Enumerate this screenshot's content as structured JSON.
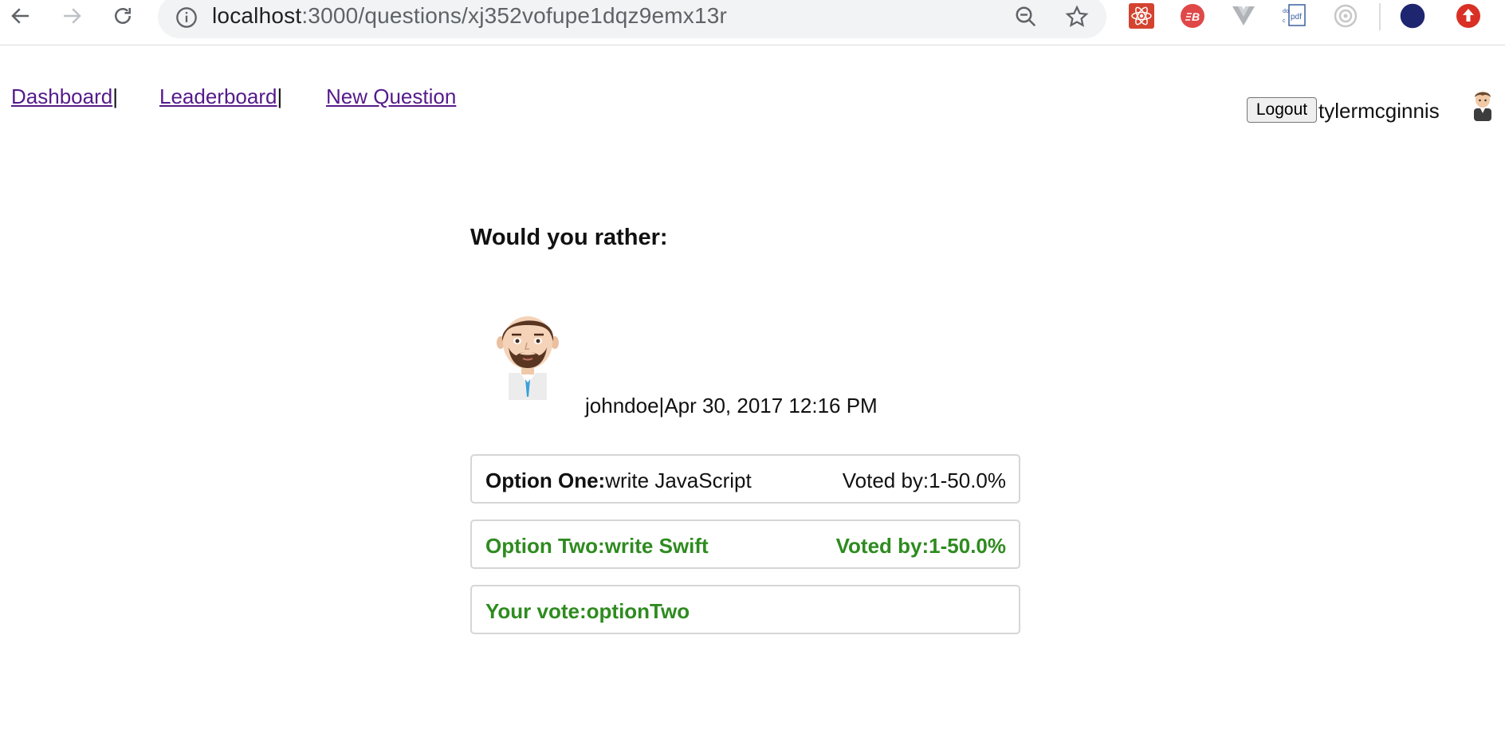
{
  "browser": {
    "url_host": "localhost",
    "url_path": ":3000/questions/xj352vofupe1dqz9emx13r",
    "icons": [
      "back-icon",
      "forward-icon",
      "reload-icon",
      "info-icon",
      "zoom-out-icon",
      "star-icon",
      "react-devtools-icon",
      "bnb-extension-icon",
      "vue-devtools-icon",
      "pdf-extension-icon",
      "redux-devtools-icon",
      "profile-icon",
      "update-icon"
    ]
  },
  "nav": {
    "dashboard": "Dashboard",
    "leaderboard": "Leaderboard",
    "new_question": "New Question",
    "separator": "|",
    "logout": "Logout",
    "username": "tylermcginnis"
  },
  "question": {
    "prompt": "Would you rather:",
    "author": "johndoe",
    "meta_separator": "|",
    "timestamp": "Apr 30, 2017 12:16 PM",
    "option_one": {
      "label": "Option One:",
      "text": "write JavaScript",
      "votes": "Voted by:1-50.0%"
    },
    "option_two": {
      "label": "Option Two:",
      "text": "write Swift",
      "votes": "Voted by:1-50.0%"
    },
    "your_vote": {
      "label": "Your vote:",
      "value": "optionTwo"
    }
  },
  "colors": {
    "voted_green": "#2e8b1f",
    "link_visited": "#551a8b",
    "border": "#d6d6d6"
  }
}
